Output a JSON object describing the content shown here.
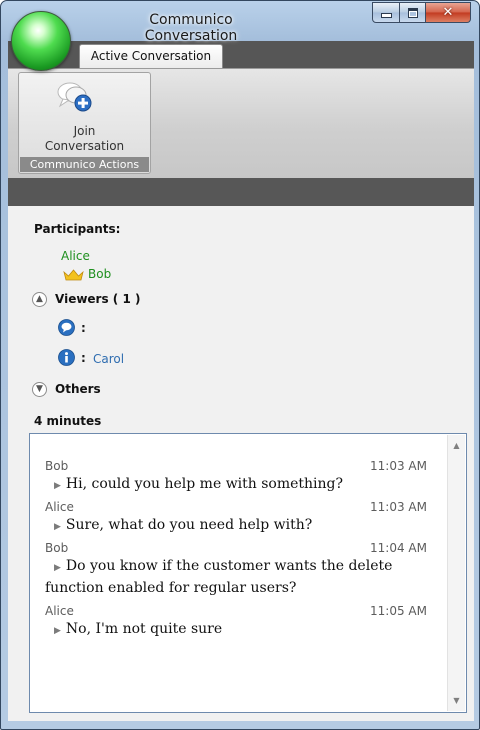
{
  "window": {
    "title": "Communico Conversation",
    "controls": {
      "minimize": "minimize-icon",
      "maximize": "maximize-icon",
      "close": "close-icon"
    }
  },
  "ribbon": {
    "tab_label": "Active Conversation",
    "join_button": {
      "line1": "Join",
      "line2": "Conversation",
      "icon": "join-conversation-icon"
    },
    "group_label": "Communico Actions"
  },
  "participants": {
    "heading": "Participants:",
    "names": [
      "Alice",
      "Bob"
    ],
    "owner_icon": "crown-icon"
  },
  "viewers": {
    "heading": "Viewers ( 1 )",
    "toggle_icon": "chevron-up-icon",
    "rows": [
      {
        "icon": "speech-bubble-icon",
        "colon": ":",
        "name": ""
      },
      {
        "icon": "info-icon",
        "colon": ":",
        "name": "Carol"
      }
    ]
  },
  "others": {
    "heading": "Others",
    "toggle_icon": "chevron-down-icon"
  },
  "duration": "4 minutes",
  "messages": [
    {
      "author": "Bob",
      "time": "11:03 AM",
      "text": "Hi, could you help me with something?"
    },
    {
      "author": "Alice",
      "time": "11:03 AM",
      "text": "Sure, what do you need help with?"
    },
    {
      "author": "Bob",
      "time": "11:04 AM",
      "text_line1": "Do you know if the customer wants the delete",
      "text_line2": "function enabled for regular users?"
    },
    {
      "author": "Alice",
      "time": "11:05 AM",
      "text": "No, I'm not quite sure"
    }
  ],
  "colors": {
    "participant_name": "#1e8f1e",
    "viewer_name": "#2f6db0",
    "dark_ribbon": "#565656"
  }
}
